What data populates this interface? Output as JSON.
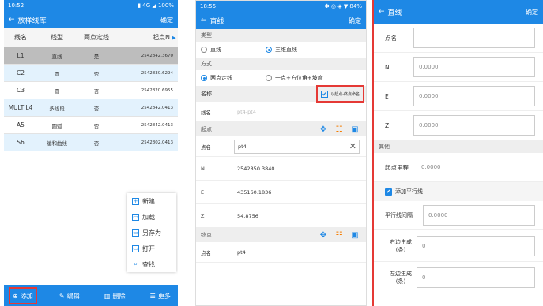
{
  "panel1": {
    "status_time": "10:52",
    "status_right": "▮ 4G ◢ 100%",
    "title": "放样线库",
    "confirm": "确定",
    "headers": [
      "线名",
      "线型",
      "两点定线",
      "起点N"
    ],
    "rows": [
      {
        "name": "L1",
        "type": "直线",
        "twopt": "是",
        "n": "2542842.3670"
      },
      {
        "name": "C2",
        "type": "圆",
        "twopt": "否",
        "n": "2542830.6294"
      },
      {
        "name": "C3",
        "type": "圆",
        "twopt": "否",
        "n": "2542820.6955"
      },
      {
        "name": "MULTIL4",
        "type": "多线段",
        "twopt": "否",
        "n": "2542842.0413"
      },
      {
        "name": "A5",
        "type": "圆弧",
        "twopt": "否",
        "n": "2542842.0413"
      },
      {
        "name": "S6",
        "type": "缓和曲线",
        "twopt": "否",
        "n": "2542802.0413"
      }
    ],
    "menu": [
      {
        "icon": "+",
        "label": "新建"
      },
      {
        "icon": "▭",
        "label": "加载"
      },
      {
        "icon": "▭",
        "label": "另存为"
      },
      {
        "icon": "▭",
        "label": "打开"
      },
      {
        "icon": "⌕",
        "label": "查找"
      }
    ],
    "bottom": {
      "add": "添加",
      "edit": "编辑",
      "delete": "删除",
      "more": "更多"
    }
  },
  "panel2": {
    "status_time": "18:55",
    "status_right": "✱ ◎ ◈ ▼ 84%",
    "title": "直线",
    "confirm": "确定",
    "type_section": "类型",
    "type_opt1": "直线",
    "type_opt2": "三维直线",
    "method_section": "方式",
    "method_opt1": "两点定线",
    "method_opt2": "一点+方位角+坡度",
    "name_section": "名称",
    "name_check": "以起点-终点命名",
    "line_name_label": "线名",
    "line_name_value": "pt4-pt4",
    "start_section": "起点",
    "point_name_label": "点名",
    "point_name_value": "pt4",
    "n_label": "N",
    "n_value": "2542850.3840",
    "e_label": "E",
    "e_value": "435160.1836",
    "z_label": "Z",
    "z_value": "54.8756",
    "end_section": "终点",
    "end_point_label": "点名",
    "end_point_value": "pt4"
  },
  "panel3": {
    "title": "直线",
    "confirm": "确定",
    "point_name_label": "点名",
    "n_label": "N",
    "n_value": "0.0000",
    "e_label": "E",
    "e_value": "0.0000",
    "z_label": "Z",
    "z_value": "0.0000",
    "other_section": "其他",
    "mileage_label": "起点里程",
    "mileage_value": "0.0000",
    "parallel_check": "添加平行线",
    "spacing_label": "平行线间隔",
    "spacing_value": "0.0000",
    "right_label": "右边生成(条)",
    "right_value": "0",
    "left_label": "左边生成(条)",
    "left_value": "0"
  },
  "colors": {
    "primary": "#1e88e5",
    "highlight": "#e53935"
  }
}
